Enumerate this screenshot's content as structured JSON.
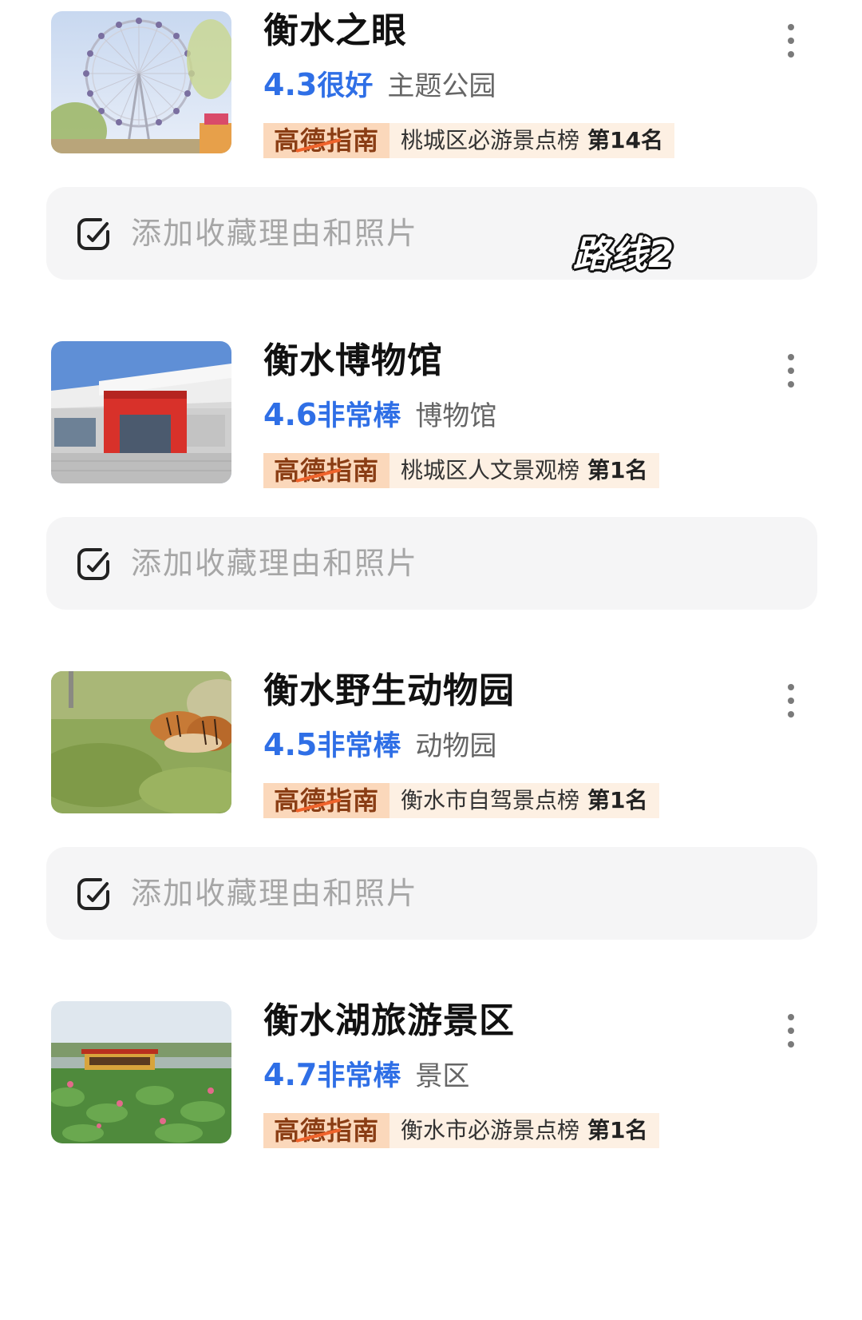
{
  "places": [
    {
      "title": "衡水之眼",
      "score": "4.3",
      "verdict": "很好",
      "category": "主题公园",
      "guide_logo": "高德指南",
      "guide_list": "桃城区必游景点榜",
      "guide_rank": "第14名",
      "note_placeholder": "添加收藏理由和照片",
      "thumbnail": "ferris-wheel-photo"
    },
    {
      "title": "衡水博物馆",
      "score": "4.6",
      "verdict": "非常棒",
      "category": "博物馆",
      "guide_logo": "高德指南",
      "guide_list": "桃城区人文景观榜",
      "guide_rank": "第1名",
      "note_placeholder": "添加收藏理由和照片",
      "thumbnail": "museum-building-photo"
    },
    {
      "title": "衡水野生动物园",
      "score": "4.5",
      "verdict": "非常棒",
      "category": "动物园",
      "guide_logo": "高德指南",
      "guide_list": "衡水市自驾景点榜",
      "guide_rank": "第1名",
      "note_placeholder": "添加收藏理由和照片",
      "thumbnail": "tigers-photo"
    },
    {
      "title": "衡水湖旅游景区",
      "score": "4.7",
      "verdict": "非常棒",
      "category": "景区",
      "guide_logo": "高德指南",
      "guide_list": "衡水市必游景点榜",
      "guide_rank": "第1名",
      "thumbnail": "lake-boat-photo"
    }
  ],
  "overlay": {
    "route_label": "路线2"
  },
  "colors": {
    "rating_blue": "#2f6fe6",
    "guide_tag_bg": "#fdf0e3",
    "guide_logo_bg": "#fbd8bb",
    "note_box_bg": "#f5f5f6"
  }
}
